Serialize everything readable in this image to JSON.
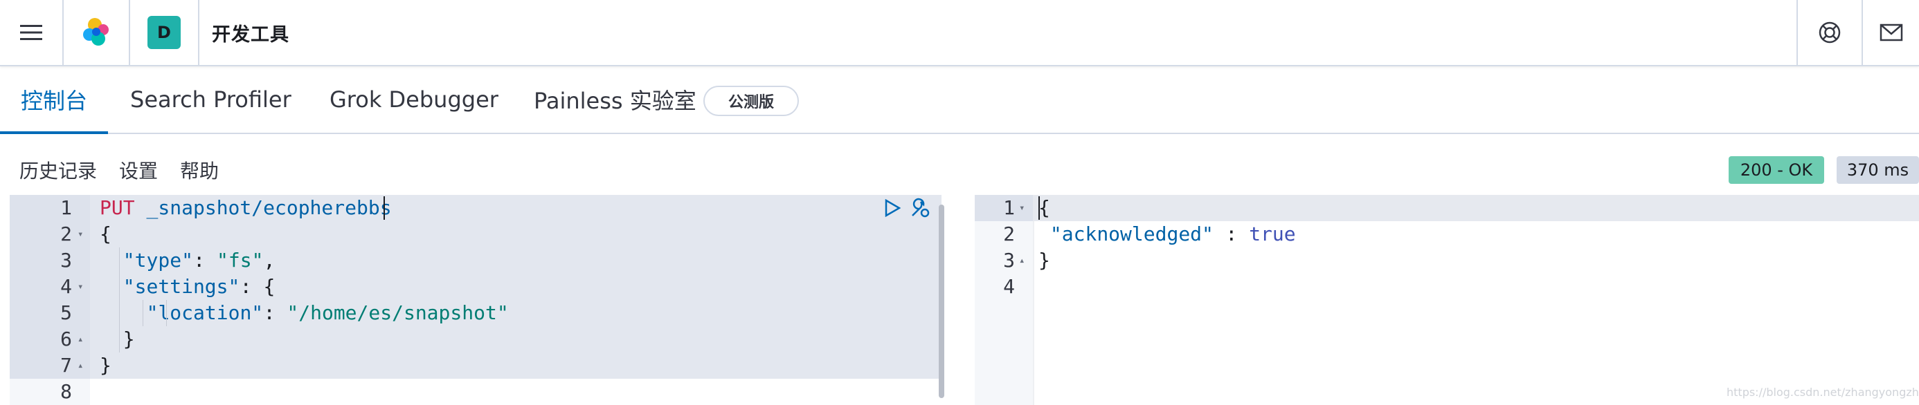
{
  "header": {
    "app_title": "开发工具",
    "space_initial": "D"
  },
  "tabs": [
    {
      "label": "控制台",
      "active": true
    },
    {
      "label": "Search Profiler",
      "active": false
    },
    {
      "label": "Grok Debugger",
      "active": false
    },
    {
      "label": "Painless 实验室",
      "active": false
    }
  ],
  "beta_badge": "公测版",
  "toolbar": {
    "history": "历史记录",
    "settings": "设置",
    "help": "帮助"
  },
  "status": {
    "code": "200 - OK",
    "time": "370 ms"
  },
  "request": {
    "method": "PUT",
    "url": " _snapshot/ecopherebbs",
    "line_numbers": [
      "1",
      "2",
      "3",
      "4",
      "5",
      "6",
      "7",
      "8"
    ],
    "lines": [
      {
        "parts": [
          {
            "t": "PUT",
            "c": "method"
          },
          {
            "t": " _snapshot/ecopherebbs",
            "c": "url"
          }
        ]
      },
      {
        "parts": [
          {
            "t": "{",
            "c": "plain"
          }
        ]
      },
      {
        "parts": [
          {
            "t": "\"type\"",
            "c": "key"
          },
          {
            "t": ": ",
            "c": "plain"
          },
          {
            "t": "\"fs\"",
            "c": "str"
          },
          {
            "t": ",",
            "c": "plain"
          }
        ]
      },
      {
        "parts": [
          {
            "t": "\"settings\"",
            "c": "key"
          },
          {
            "t": ": {",
            "c": "plain"
          }
        ]
      },
      {
        "parts": [
          {
            "t": "\"location\"",
            "c": "key"
          },
          {
            "t": ": ",
            "c": "plain"
          },
          {
            "t": "\"/home/es/snapshot\"",
            "c": "str"
          }
        ]
      },
      {
        "parts": [
          {
            "t": "}",
            "c": "plain"
          }
        ]
      },
      {
        "parts": [
          {
            "t": "}",
            "c": "plain"
          }
        ]
      },
      {
        "parts": []
      }
    ]
  },
  "response": {
    "line_numbers": [
      "1",
      "2",
      "3",
      "4"
    ],
    "lines": [
      {
        "parts": [
          {
            "t": "{",
            "c": "plain"
          }
        ]
      },
      {
        "parts": [
          {
            "t": "\"acknowledged\"",
            "c": "key"
          },
          {
            "t": " : ",
            "c": "plain"
          },
          {
            "t": "true",
            "c": "bool"
          }
        ]
      },
      {
        "parts": [
          {
            "t": "}",
            "c": "plain"
          }
        ]
      },
      {
        "parts": []
      }
    ]
  },
  "watermark": "https://blog.csdn.net/zhangyongzhangyong",
  "colors": {
    "accent": "#006bb8",
    "status_ok": "#6dccb1",
    "space_avatar": "#20b2aa"
  }
}
